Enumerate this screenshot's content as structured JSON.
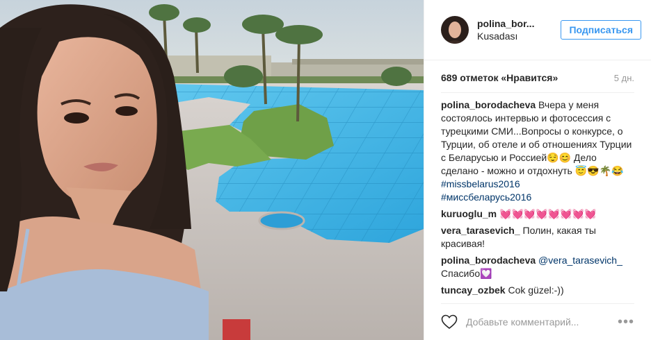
{
  "post": {
    "username": "polina_bor...",
    "location": "Kusadası",
    "follow_label": "Подписаться",
    "likes": "689 отметок «Нравится»",
    "age": "5 дн."
  },
  "caption": {
    "username": "polina_borodacheva",
    "text": "Вчера у меня состоялось интервью и фотосессия с турецкими СМИ...Вопросы о конкурсе, о Турции, об отеле и об отношениях Турции с Беларусью и Россией😌😊 Дело сделано - можно и отдохнуть 😇😎🌴😂",
    "hashtag1": "#missbelarus2016",
    "hashtag2": "#миссбеларусь2016"
  },
  "comments": [
    {
      "username": "kuruoglu_m",
      "text": "💓💓💓💓💓💓💓💓"
    },
    {
      "username": "vera_tarasevich_",
      "text": "Полин, какая ты красивая!"
    },
    {
      "username": "polina_borodacheva",
      "mention": "@vera_tarasevich_",
      "text": "Спасибо💟"
    },
    {
      "username": "tuncay_ozbek",
      "text": "Cok güzel:-))"
    }
  ],
  "footer": {
    "add_comment_placeholder": "Добавьте комментарий...",
    "more": "•••",
    "icons": [
      "heart-icon",
      "more-options-icon"
    ]
  },
  "colors": {
    "accent": "#3897f0",
    "link": "#003569",
    "pool": "#3fb6e6"
  }
}
